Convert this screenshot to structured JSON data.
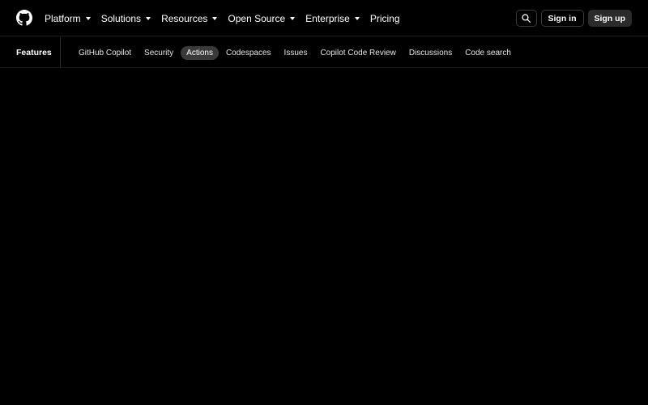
{
  "header": {
    "logo_icon": "github-mark-icon",
    "menu": [
      {
        "label": "Platform",
        "dropdown": true
      },
      {
        "label": "Solutions",
        "dropdown": true
      },
      {
        "label": "Resources",
        "dropdown": true
      },
      {
        "label": "Open Source",
        "dropdown": true
      },
      {
        "label": "Enterprise",
        "dropdown": true
      },
      {
        "label": "Pricing",
        "dropdown": false
      }
    ],
    "search_icon": "search-icon",
    "sign_in_label": "Sign in",
    "sign_up_label": "Sign up"
  },
  "subnav": {
    "title": "Features",
    "links": [
      {
        "label": "GitHub Copilot"
      },
      {
        "label": "Security"
      },
      {
        "label": "Actions",
        "active": true
      },
      {
        "label": "Codespaces"
      },
      {
        "label": "Issues"
      },
      {
        "label": "Copilot Code Review"
      },
      {
        "label": "Discussions"
      },
      {
        "label": "Code search"
      }
    ]
  },
  "colors": {
    "background": "#000000",
    "text": "#ffffff",
    "active_pill": "#3a3a3a",
    "signup_bg": "#2b2b2b"
  }
}
